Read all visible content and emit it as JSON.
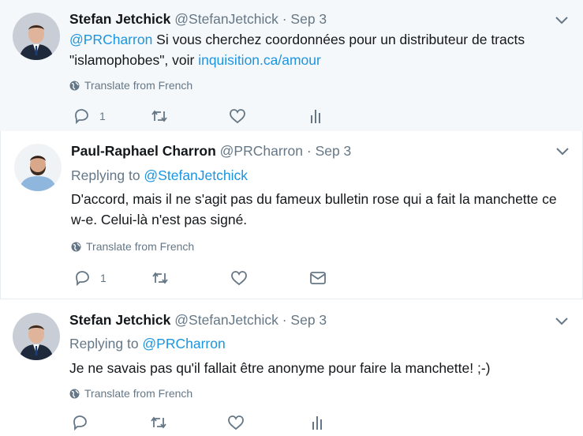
{
  "tweets": [
    {
      "name": "Stefan Jetchick",
      "handle": "@StefanJetchick",
      "sep": "·",
      "date": "Sep 3",
      "mention": "@PRCharron",
      "text_a": " Si vous cherchez coordonnées pour un distributeur de tracts",
      "text_b": "\"islamophobes\", voir ",
      "link": "inquisition.ca/amour",
      "translate": "Translate from French",
      "reply_count": "1"
    },
    {
      "name": "Paul-Raphael Charron",
      "handle": "@PRCharron",
      "sep": "·",
      "date": "Sep 3",
      "replying_label": "Replying to ",
      "replying_to": "@StefanJetchick",
      "text_a": "D'accord, mais il ne s'agit pas du fameux bulletin rose qui a fait la manchette ce",
      "text_b": "w-e. Celui-là n'est pas signé.",
      "translate": "Translate from French",
      "reply_count": "1"
    },
    {
      "name": "Stefan Jetchick",
      "handle": "@StefanJetchick",
      "sep": "·",
      "date": "Sep 3",
      "replying_label": "Replying to ",
      "replying_to": "@PRCharron",
      "text_a": "Je ne savais pas qu'il fallait être anonyme pour faire la manchette!  ;-)",
      "translate": "Translate from French"
    }
  ],
  "colors": {
    "link": "#1b95e0",
    "muted": "#657786",
    "highlight_bg": "#f5f8fa"
  },
  "icons": [
    "chevron-down-icon",
    "globe-icon",
    "reply-icon",
    "retweet-icon",
    "like-icon",
    "analytics-icon",
    "message-icon"
  ]
}
